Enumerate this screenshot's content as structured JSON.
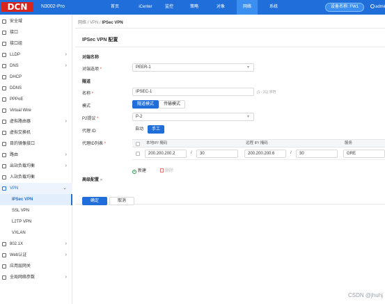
{
  "header": {
    "logo_text": "DCN",
    "model": "N3002-Pro",
    "nav": [
      "首页",
      "iCenter",
      "监控",
      "策略",
      "对象",
      "网络",
      "系统"
    ],
    "active_nav": "网络",
    "device_label": "设备名称: FW1",
    "user": "admin",
    "brand_color": "#1f6ed9",
    "logo_color": "#d7261e"
  },
  "sidebar": {
    "items": [
      {
        "label": "安全域",
        "icon": "shield-icon",
        "arrow": false
      },
      {
        "label": "接口",
        "icon": "interface-icon",
        "arrow": false
      },
      {
        "label": "接口组",
        "icon": "interface-group-icon",
        "arrow": false
      },
      {
        "label": "LLDP",
        "icon": "lldp-icon",
        "arrow": true
      },
      {
        "label": "DNS",
        "icon": "dns-icon",
        "arrow": true
      },
      {
        "label": "DHCP",
        "icon": "dhcp-icon",
        "arrow": false
      },
      {
        "label": "DDNS",
        "icon": "ddns-icon",
        "arrow": false
      },
      {
        "label": "PPPoE",
        "icon": "pppoe-icon",
        "arrow": false
      },
      {
        "label": "Virtual Wire",
        "icon": "virtual-wire-icon",
        "arrow": false
      },
      {
        "label": "虚拟路由器",
        "icon": "virtual-router-icon",
        "arrow": true
      },
      {
        "label": "虚拟交换机",
        "icon": "virtual-switch-icon",
        "arrow": false
      },
      {
        "label": "目的镜像接口",
        "icon": "mirror-icon",
        "arrow": false
      },
      {
        "label": "路由",
        "icon": "route-icon",
        "arrow": true
      },
      {
        "label": "出站负载均衡",
        "icon": "outbound-lb-icon",
        "arrow": true
      },
      {
        "label": "入站负载均衡",
        "icon": "inbound-lb-icon",
        "arrow": false
      },
      {
        "label": "VPN",
        "icon": "vpn-icon",
        "arrow": true
      },
      {
        "label": "IPSec VPN",
        "sub": true
      },
      {
        "label": "SSL VPN",
        "sub": true
      },
      {
        "label": "L2TP VPN",
        "sub": true
      },
      {
        "label": "VXLAN",
        "sub": true
      },
      {
        "label": "802.1X",
        "icon": "dot1x-icon",
        "arrow": true
      },
      {
        "label": "Web认证",
        "icon": "web-auth-icon",
        "arrow": true
      },
      {
        "label": "应用层网关",
        "icon": "alg-icon",
        "arrow": false
      },
      {
        "label": "全局网络参数",
        "icon": "global-params-icon",
        "arrow": true
      }
    ]
  },
  "breadcrumb": {
    "path": "网络 / VPN / ",
    "current": "IPSec VPN"
  },
  "page_title": "IPSec VPN 配置",
  "form": {
    "section_peer": "对端名称",
    "peer_label": "对端选项",
    "peer_value": "PEER-1",
    "section_tunnel": "隧道",
    "name_label": "名称",
    "name_value": "IPSEC-1",
    "name_hint": "(1 - 31) 字符",
    "mode_label": "模式",
    "mode_tunnel": "隧道模式",
    "mode_transport": "传输模式",
    "p2_label": "P2提议",
    "p2_value": "P-2",
    "proxy_id_label": "代理 ID",
    "proxy_auto": "自动",
    "proxy_manual": "手工",
    "proxy_list_label": "代理ID列表",
    "table": {
      "headers": [
        "本地IP/ 掩码",
        "远程 IP/ 掩码",
        "服务"
      ],
      "rows": [
        {
          "local_ip": "200.200.200.2",
          "local_mask": "30",
          "remote_ip": "200.200.200.6",
          "remote_mask": "30",
          "service": "GRE"
        }
      ],
      "add_label": "新建",
      "delete_label": "删除"
    },
    "advanced_label": "高级配置",
    "ok_label": "确定",
    "cancel_label": "取消"
  },
  "watermark": "CSDN @jhuhj"
}
